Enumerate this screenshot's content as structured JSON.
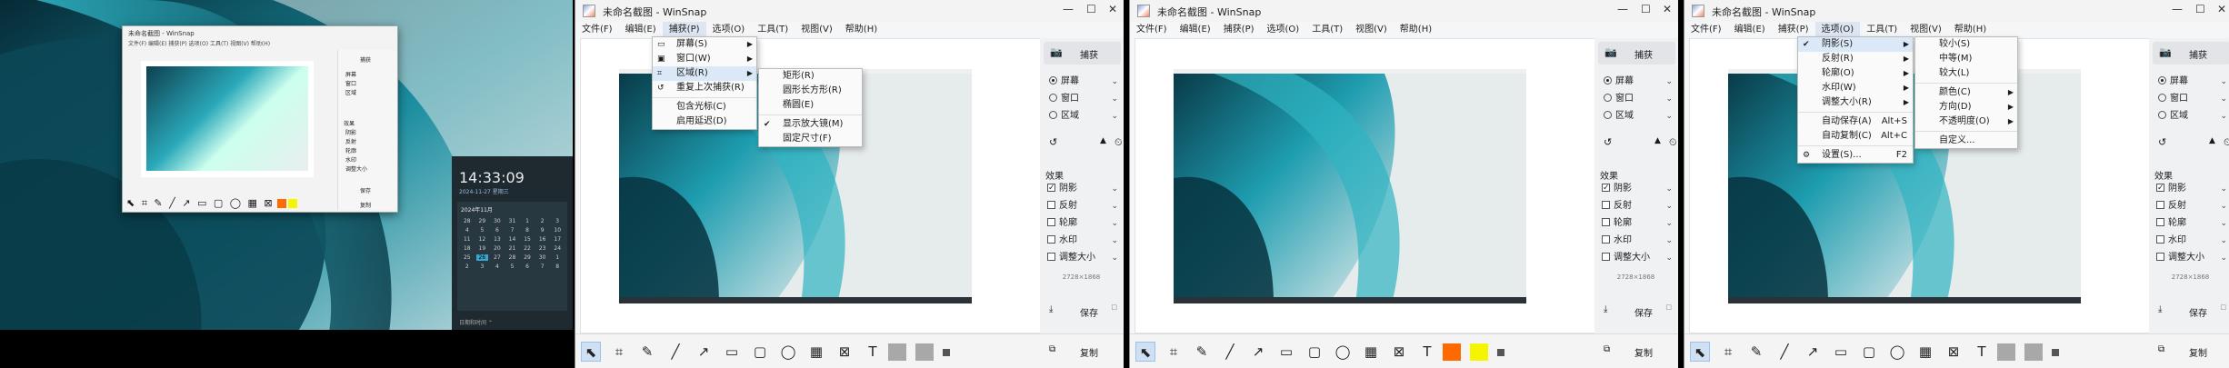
{
  "desktop": {
    "mini_title": "未命名截图 - WinSnap",
    "mini_menu": "文件(F) 编辑(E) 捕获(P) 选项(O) 工具(T) 视图(V) 帮助(H)",
    "mini_capture": "捕获",
    "mini_modes": [
      "屏幕",
      "窗口",
      "区域"
    ],
    "mini_effects_header": "效果",
    "mini_effects": [
      "阴影",
      "反射",
      "轮廓",
      "水印",
      "调整大小"
    ],
    "mini_save": "保存",
    "mini_copy": "复制",
    "mini_tools": "⬉ ⌗ ✎ ╱ ↗ ▭ ▢ ◯ ▦ ⊠ T",
    "clock_time": "14:33:09",
    "clock_date": "2024-11-27 星期三",
    "cal_month": "2024年11月",
    "cal_days": [
      "28",
      "29",
      "30",
      "31",
      "1",
      "2",
      "3",
      "4",
      "5",
      "6",
      "7",
      "8",
      "9",
      "10",
      "11",
      "12",
      "13",
      "14",
      "15",
      "16",
      "17",
      "18",
      "19",
      "20",
      "21",
      "22",
      "23",
      "24",
      "25",
      "26",
      "27",
      "28",
      "29",
      "30",
      "1",
      "2",
      "3",
      "4",
      "5",
      "6",
      "7",
      "8"
    ],
    "cal_selected_index": 29,
    "clock_footer": "日期和时间 ⌃"
  },
  "windows": [
    {
      "title": "未命名截图 - WinSnap",
      "menu": [
        "文件(F)",
        "编辑(E)",
        "捕获(P)",
        "选项(O)",
        "工具(T)",
        "视图(V)",
        "帮助(H)"
      ],
      "active_menu": 2,
      "capture_label": "捕获",
      "modes": [
        {
          "label": "屏幕",
          "on": true
        },
        {
          "label": "窗口",
          "on": false
        },
        {
          "label": "区域",
          "on": false
        }
      ],
      "effects_header": "效果",
      "effects": [
        {
          "label": "阴影",
          "on": true
        },
        {
          "label": "反射",
          "on": false
        },
        {
          "label": "轮廓",
          "on": false
        },
        {
          "label": "水印",
          "on": false
        },
        {
          "label": "调整大小",
          "on": false
        }
      ],
      "dimensions": "2728×1868",
      "save_label": "保存",
      "copy_label": "复制",
      "swatches": [
        "#a8a8a8",
        "#a8a8a8"
      ],
      "selected_tool": 0
    },
    {
      "title": "未命名截图 - WinSnap",
      "menu": [
        "文件(F)",
        "编辑(E)",
        "捕获(P)",
        "选项(O)",
        "工具(T)",
        "视图(V)",
        "帮助(H)"
      ],
      "active_menu": -1,
      "capture_label": "捕获",
      "modes": [
        {
          "label": "屏幕",
          "on": true
        },
        {
          "label": "窗口",
          "on": false
        },
        {
          "label": "区域",
          "on": false
        }
      ],
      "effects_header": "效果",
      "effects": [
        {
          "label": "阴影",
          "on": true
        },
        {
          "label": "反射",
          "on": false
        },
        {
          "label": "轮廓",
          "on": false
        },
        {
          "label": "水印",
          "on": false
        },
        {
          "label": "调整大小",
          "on": false
        }
      ],
      "dimensions": "2728×1868",
      "save_label": "保存",
      "copy_label": "复制",
      "swatches": [
        "#ff6a00",
        "#f5f500"
      ],
      "selected_tool": 0
    },
    {
      "title": "未命名截图 - WinSnap",
      "menu": [
        "文件(F)",
        "编辑(E)",
        "捕获(P)",
        "选项(O)",
        "工具(T)",
        "视图(V)",
        "帮助(H)"
      ],
      "active_menu": 3,
      "capture_label": "捕获",
      "modes": [
        {
          "label": "屏幕",
          "on": true
        },
        {
          "label": "窗口",
          "on": false
        },
        {
          "label": "区域",
          "on": false
        }
      ],
      "effects_header": "效果",
      "effects": [
        {
          "label": "阴影",
          "on": true
        },
        {
          "label": "反射",
          "on": false
        },
        {
          "label": "轮廓",
          "on": false
        },
        {
          "label": "水印",
          "on": false
        },
        {
          "label": "调整大小",
          "on": false
        }
      ],
      "dimensions": "2728×1868",
      "save_label": "保存",
      "copy_label": "复制",
      "swatches": [
        "#a8a8a8",
        "#a8a8a8"
      ],
      "selected_tool": 0
    }
  ],
  "capture_menu": {
    "items": [
      {
        "label": "屏幕(S)",
        "icon": "▭",
        "arrow": true
      },
      {
        "label": "窗口(W)",
        "icon": "▣",
        "arrow": true
      },
      {
        "label": "区域(R)",
        "icon": "⌗",
        "arrow": true,
        "hl": true
      },
      {
        "label": "重复上次捕获(R)",
        "icon": "↺",
        "arrow": false
      },
      {
        "sep": true
      },
      {
        "label": "包含光标(C)",
        "icon": "",
        "arrow": false
      },
      {
        "label": "启用延迟(D)",
        "icon": "",
        "arrow": false
      }
    ],
    "sub": [
      {
        "label": "矩形(R)",
        "check": false
      },
      {
        "label": "圆形长方形(R)",
        "check": false
      },
      {
        "label": "椭圆(E)",
        "check": false
      },
      {
        "sep": true
      },
      {
        "label": "显示放大镜(M)",
        "check": true
      },
      {
        "label": "固定尺寸(F)",
        "check": false
      }
    ]
  },
  "options_menu": {
    "items": [
      {
        "label": "阴影(S)",
        "arrow": true,
        "check": true,
        "hl": true
      },
      {
        "label": "反射(R)",
        "arrow": true
      },
      {
        "label": "轮廓(O)",
        "arrow": true
      },
      {
        "label": "水印(W)",
        "arrow": true
      },
      {
        "label": "调整大小(R)",
        "arrow": true
      },
      {
        "sep": true
      },
      {
        "label": "自动保存(A)",
        "sc": "Alt+S"
      },
      {
        "label": "自动复制(C)",
        "sc": "Alt+C"
      },
      {
        "sep": true
      },
      {
        "label": "设置(S)...",
        "sc": "F2",
        "icon": "⚙"
      }
    ],
    "sub": [
      {
        "label": "较小(S)"
      },
      {
        "label": "中等(M)"
      },
      {
        "label": "较大(L)"
      },
      {
        "sep": true
      },
      {
        "label": "颜色(C)",
        "arrow": true
      },
      {
        "label": "方向(D)",
        "arrow": true
      },
      {
        "label": "不透明度(O)",
        "arrow": true
      },
      {
        "sep": true
      },
      {
        "label": "自定义..."
      }
    ]
  },
  "icons": {
    "capture": "camera-icon",
    "refresh": "↺",
    "cursor": "▲",
    "timer": "⏲",
    "save": "⤓",
    "copy": "⧉"
  }
}
